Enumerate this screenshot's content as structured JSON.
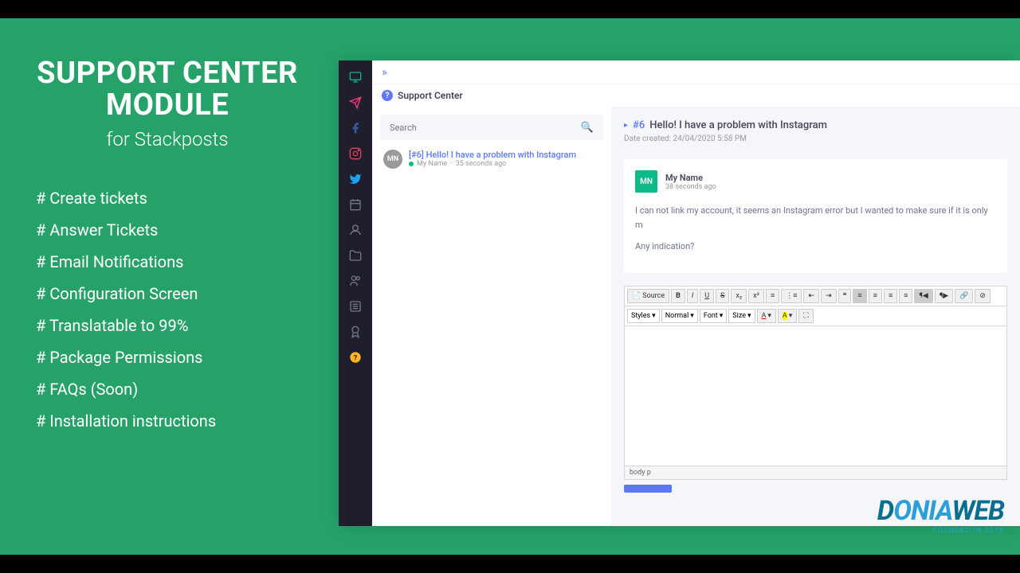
{
  "promo": {
    "title1": "SUPPORT CENTER",
    "title2": "MODULE",
    "subtitle": "for Stackposts",
    "features": [
      "# Create tickets",
      "# Answer Tickets",
      "# Email Notifications",
      "# Configuration Screen",
      "# Translatable to 99%",
      "# Package Permissions",
      "# FAQs (Soon)",
      "# Installation instructions"
    ]
  },
  "app": {
    "pageTitle": "Support Center",
    "search": {
      "placeholder": "Search"
    },
    "ticketList": [
      {
        "avatar": "MN",
        "title": "[#6] Hello! I have a problem with Instagram",
        "author": "My Name",
        "time": "35 seconds ago"
      }
    ],
    "detail": {
      "number": "#6",
      "title": "Hello! I have a problem with Instagram",
      "dateLabel": "Date created: 24/04/2020 5:58 PM",
      "message": {
        "avatar": "MN",
        "name": "My Name",
        "time": "38 seconds ago",
        "body1": "I can not link my account, it seems an Instagram error but I wanted to make sure if it is only m",
        "body2": "Any indication?"
      }
    },
    "editor": {
      "source": "Source",
      "styles": "Styles",
      "format": "Normal",
      "font": "Font",
      "size": "Size",
      "path": "body  p"
    }
  },
  "logo": {
    "text1": "D",
    "text2": "ONIA",
    "text3": "WEB",
    "founded": "FOUNDED IN 2018"
  }
}
